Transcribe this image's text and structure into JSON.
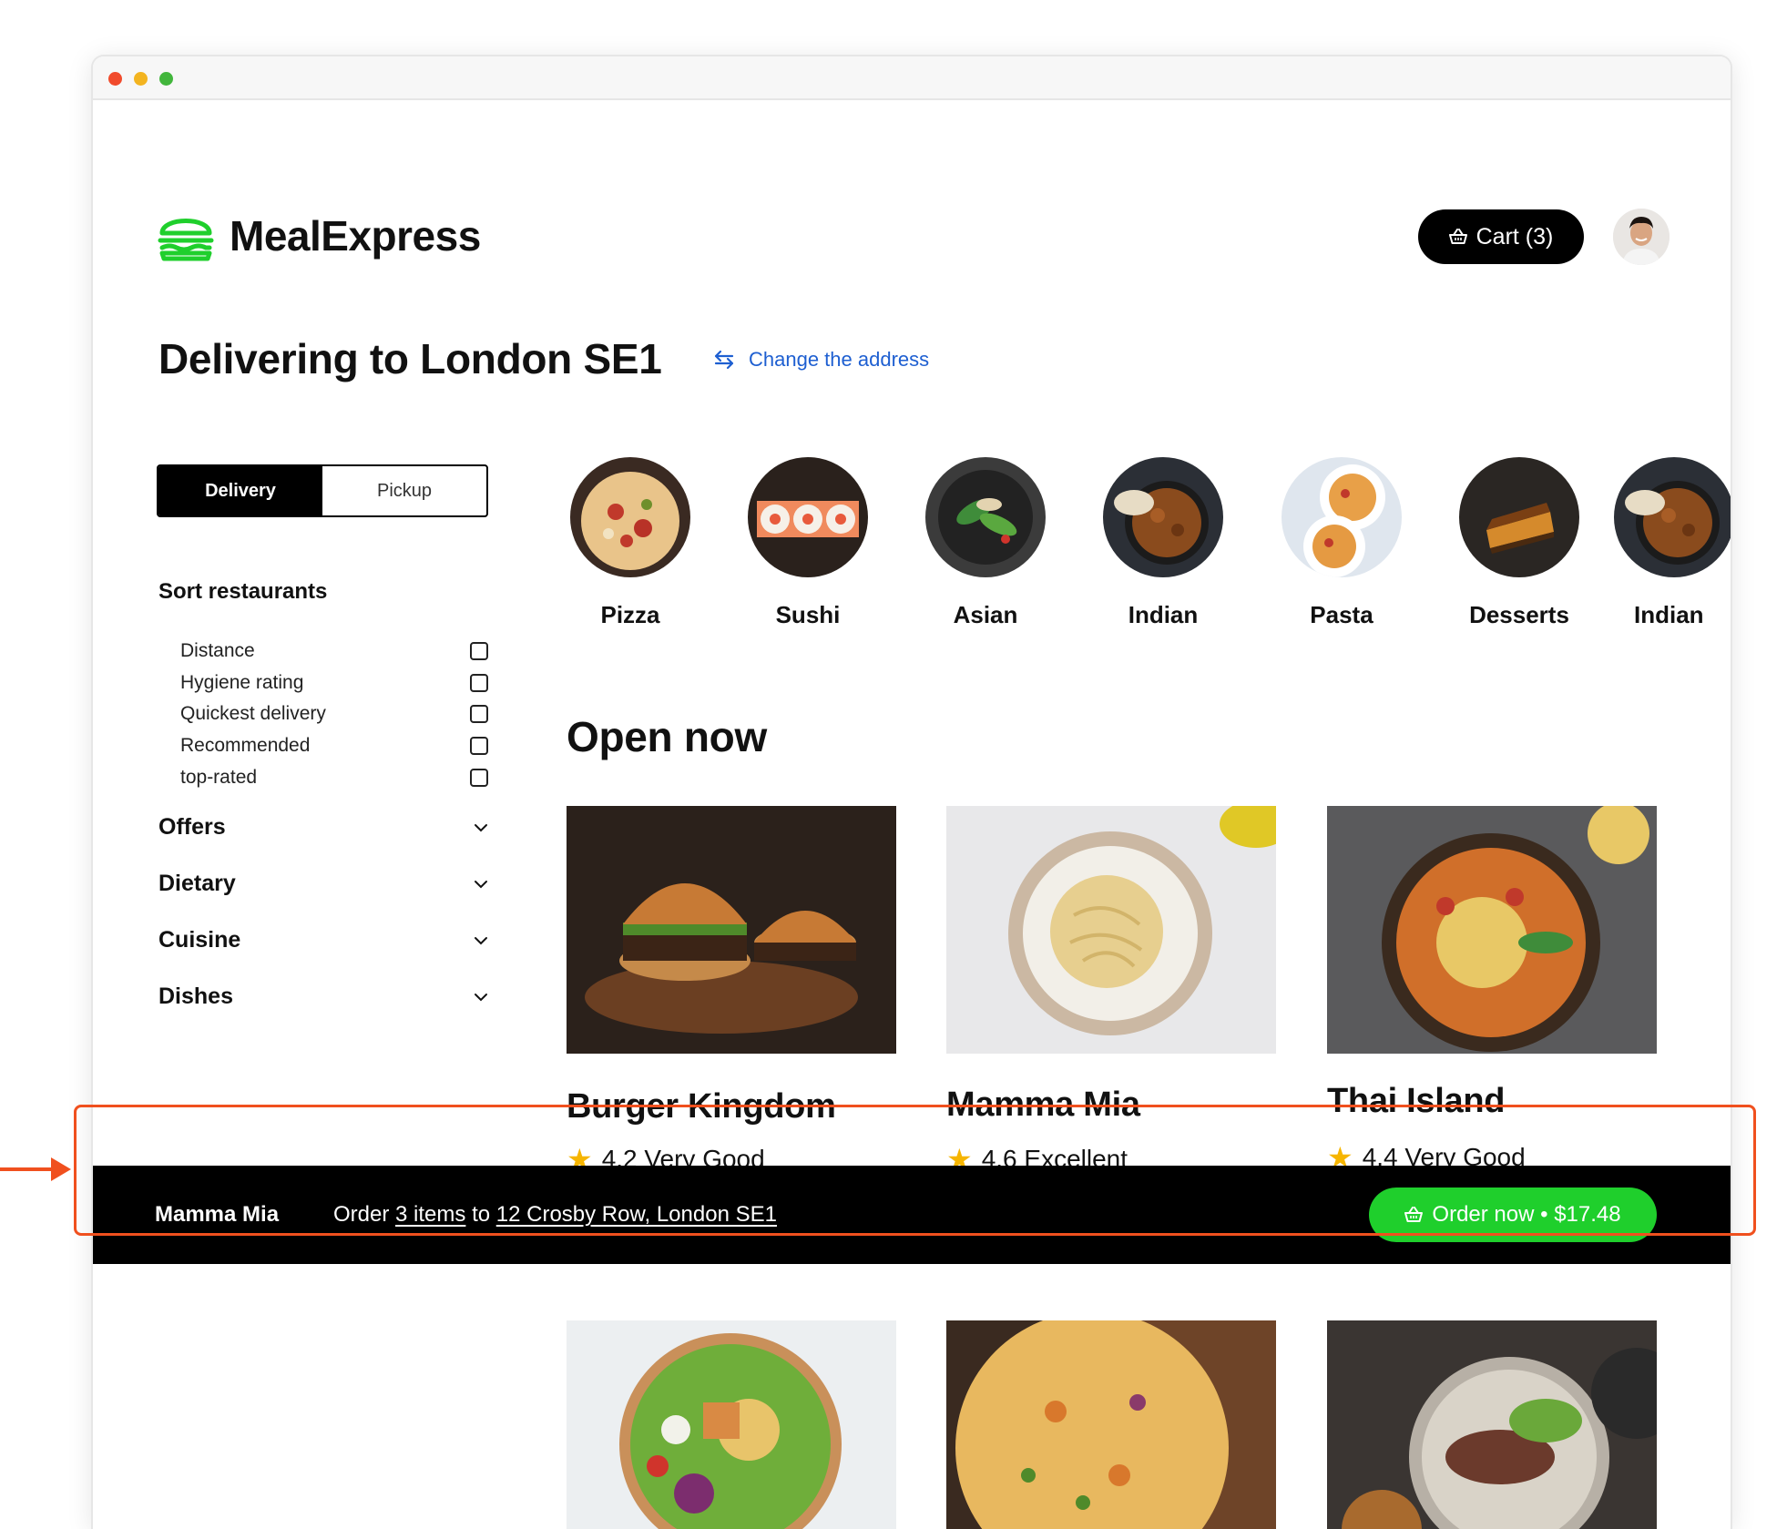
{
  "app": {
    "name": "MealExpress"
  },
  "header": {
    "cart_label": "Cart (3)",
    "avatar_alt": "user-avatar"
  },
  "page": {
    "title": "Delivering to London SE1",
    "change_address": "Change the address"
  },
  "sidebar": {
    "mode_tabs": [
      "Delivery",
      "Pickup"
    ],
    "active_mode": "Delivery",
    "sort_heading": "Sort restaurants",
    "sort_options": [
      "Distance",
      "Hygiene rating",
      "Quickest delivery",
      "Recommended",
      "top-rated"
    ],
    "filters": [
      "Offers",
      "Dietary",
      "Cuisine",
      "Dishes"
    ]
  },
  "categories": [
    {
      "label": "Pizza"
    },
    {
      "label": "Sushi"
    },
    {
      "label": "Asian"
    },
    {
      "label": "Indian"
    },
    {
      "label": "Pasta"
    },
    {
      "label": "Desserts"
    },
    {
      "label": "Indian"
    }
  ],
  "open_now": {
    "heading": "Open now",
    "restaurants": [
      {
        "name": "Burger Kingdom",
        "rating": "4.2 Very Good"
      },
      {
        "name": "Mamma Mia",
        "rating": "4.6 Excellent"
      },
      {
        "name": "Thai Island",
        "rating": "4.4 Very Good"
      }
    ]
  },
  "order_bar": {
    "restaurant": "Mamma Mia",
    "text_order": "Order",
    "items": "3 items",
    "text_to": "to",
    "address": "12 Crosby Row, London SE1",
    "button_label": "Order now • $17.48"
  },
  "colors": {
    "brand_green": "#1fcf2c",
    "link_blue": "#1e5fd1",
    "annotation_orange": "#f0501e",
    "star_yellow": "#f6b500"
  }
}
